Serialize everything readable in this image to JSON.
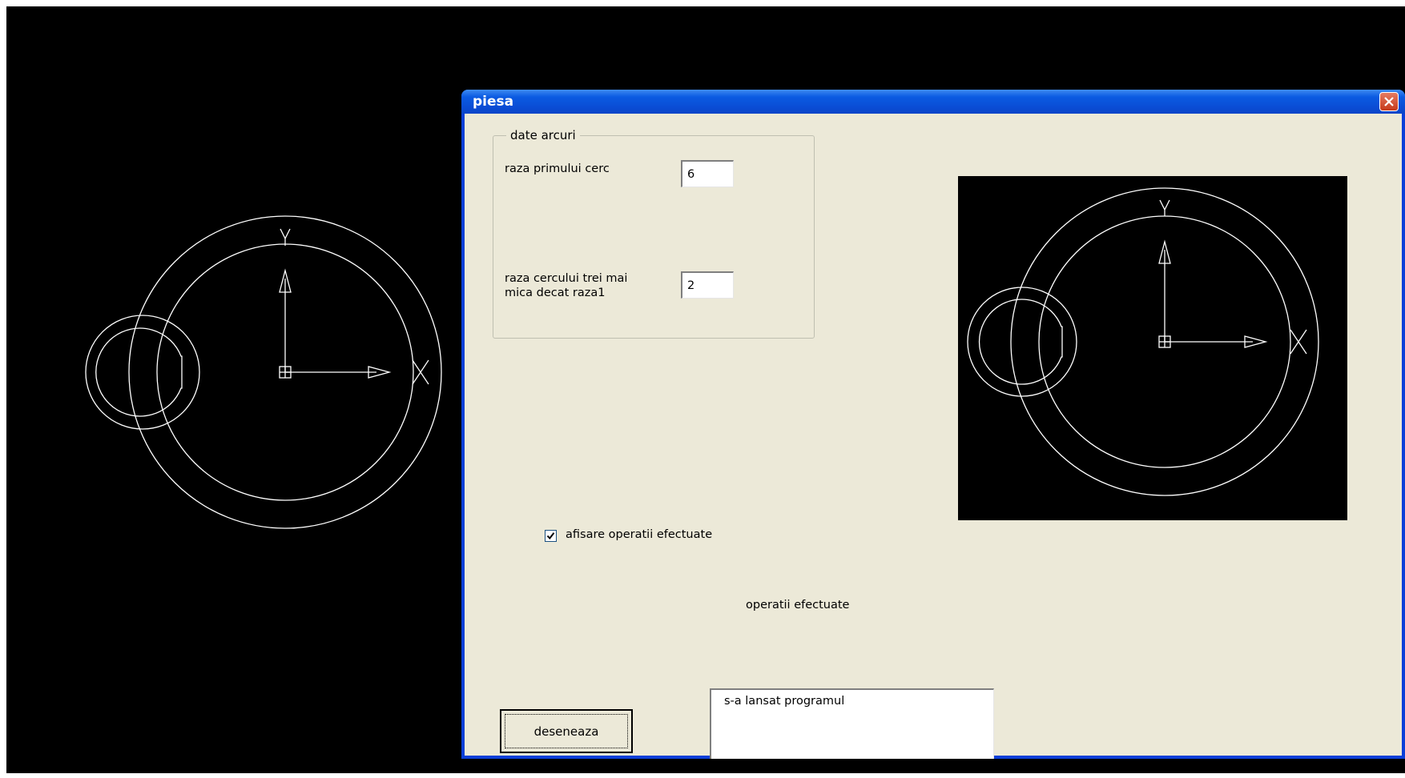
{
  "window": {
    "title": "piesa"
  },
  "group": {
    "legend": "date arcuri",
    "radius1_label": "raza primului cerc",
    "radius1_value": "6",
    "radius3_label_line1": "raza cercului trei mai",
    "radius3_label_line2": "mica decat raza1",
    "radius3_value": "2"
  },
  "options": {
    "show_ops_label": "afisare operatii efectuate",
    "show_ops_checked": true
  },
  "ops": {
    "label": "operatii efectuate",
    "items": [
      "s-a lansat programul"
    ]
  },
  "actions": {
    "draw_label": "deseneaza"
  },
  "drawing": {
    "axis_x_label": "X",
    "axis_y_label": "Y"
  },
  "icons": {
    "close": "close-icon",
    "check": "check-icon"
  },
  "colors": {
    "title_bar": "#0a4ed6",
    "client_bg": "#ece9d8",
    "canvas_bg": "#000000",
    "geometry": "#ffffff",
    "close_button": "#c63a1a"
  }
}
